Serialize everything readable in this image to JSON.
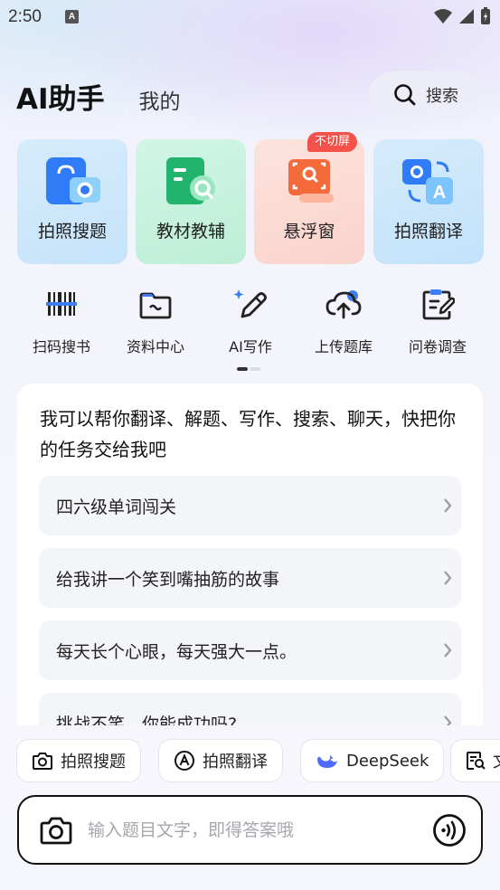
{
  "status_bar": {
    "time": "2:50",
    "notification_glyph": "A"
  },
  "header": {
    "tabs": [
      {
        "label": "AI助手",
        "active": true
      },
      {
        "label": "我的",
        "active": false
      }
    ],
    "search_label": "搜索"
  },
  "feature_cards": [
    {
      "label": "拍照搜题",
      "icon": "camera-search-icon",
      "bg": "#cfe8fb"
    },
    {
      "label": "教材教辅",
      "icon": "textbook-icon",
      "bg": "#c9f1df"
    },
    {
      "label": "悬浮窗",
      "icon": "floating-window-icon",
      "bg": "#fcdcd6",
      "badge": "不切屏"
    },
    {
      "label": "拍照翻译",
      "icon": "photo-translate-icon",
      "bg": "#cde8fb"
    }
  ],
  "tools": [
    {
      "label": "扫码搜书",
      "icon": "barcode-icon"
    },
    {
      "label": "资料中心",
      "icon": "folder-icon"
    },
    {
      "label": "AI写作",
      "icon": "ai-pen-icon"
    },
    {
      "label": "上传题库",
      "icon": "cloud-upload-icon"
    },
    {
      "label": "问卷调查",
      "icon": "survey-icon"
    }
  ],
  "chat": {
    "intro": "我可以帮你翻译、解题、写作、搜索、聊天，快把你的任务交给我吧",
    "suggestions": [
      "四六级单词闯关",
      "给我讲一个笑到嘴抽筋的故事",
      "每天长个心眼，每天强大一点。",
      "挑战不笑，你能成功吗?"
    ]
  },
  "quick_chips": [
    {
      "label": "拍照搜题",
      "icon": "camera-icon"
    },
    {
      "label": "拍照翻译",
      "icon": "translate-icon"
    },
    {
      "label": "DeepSeek",
      "icon": "deepseek-icon"
    },
    {
      "label": "文",
      "icon": "doc-search-icon"
    }
  ],
  "input": {
    "placeholder": "输入题目文字，即得答案哦"
  },
  "colors": {
    "accent_blue": "#2f7cf6",
    "badge_red": "#f2524a",
    "deepseek_blue": "#4d6bfe"
  }
}
